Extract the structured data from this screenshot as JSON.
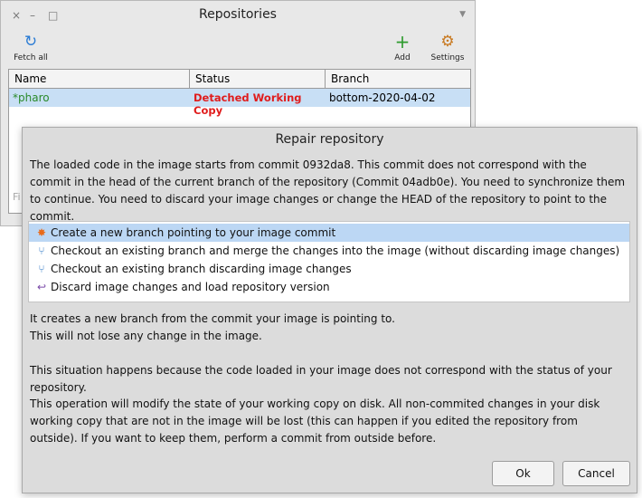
{
  "repo_window": {
    "title": "Repositories",
    "controls": {
      "close": "×",
      "minimize": "–",
      "maximize": "□"
    },
    "toolbar": {
      "fetch_all": {
        "label": "Fetch all",
        "icon": "refresh-icon",
        "glyph": "↻",
        "color": "#2a7bd4"
      },
      "add": {
        "label": "Add",
        "icon": "plus-icon",
        "glyph": "+",
        "color": "#2e9b2e"
      },
      "settings": {
        "label": "Settings",
        "icon": "wrench-gear-icon",
        "glyph": "⚙",
        "color": "#c8781e"
      }
    },
    "columns": [
      "Name",
      "Status",
      "Branch"
    ],
    "rows": [
      {
        "name": "*pharo",
        "status": "Detached Working Copy",
        "branch": "bottom-2020-04-02",
        "name_color": "#2a8a2a",
        "status_color": "#e01c1c"
      }
    ],
    "filter_placeholder": "Fi"
  },
  "dialog": {
    "title": "Repair repository",
    "description": "The loaded code in the image starts from commit 0932da8. This commit does not correspond with the commit in the head of the current branch of the repository (Commit 04adb0e). You need to synchronize them to continue. You need to discard your image changes or change the HEAD of the repository to point to the commit.",
    "options": [
      {
        "label": "Create a new branch pointing to your image commit",
        "icon": "new-branch-icon",
        "glyph": "✸",
        "color": "#e86a1a",
        "selected": true
      },
      {
        "label": "Checkout an existing branch and merge the changes into the image (without discarding image changes)",
        "icon": "merge-icon",
        "glyph": "⑂",
        "color": "#3a7fc8",
        "selected": false
      },
      {
        "label": "Checkout an existing branch discarding image changes",
        "icon": "branch-icon",
        "glyph": "⑂",
        "color": "#3a7fc8",
        "selected": false
      },
      {
        "label": "Discard image changes and load repository version",
        "icon": "undo-icon",
        "glyph": "↩",
        "color": "#7a4aa8",
        "selected": false
      }
    ],
    "explanation_line1": "It creates a new branch from the commit your image is pointing to.",
    "explanation_line2": "This will not lose any change in the image.",
    "situation": "This situation happens because the code loaded in your image does not correspond with the status of your repository.",
    "warning": "This operation will modify the state of your working copy on disk. All non-commited changes in your disk working copy that are not in the image will be lost (this can happen if you edited the repository from outside). If you want to keep them, perform a commit from outside before.",
    "ok_label": "Ok",
    "cancel_label": "Cancel"
  }
}
